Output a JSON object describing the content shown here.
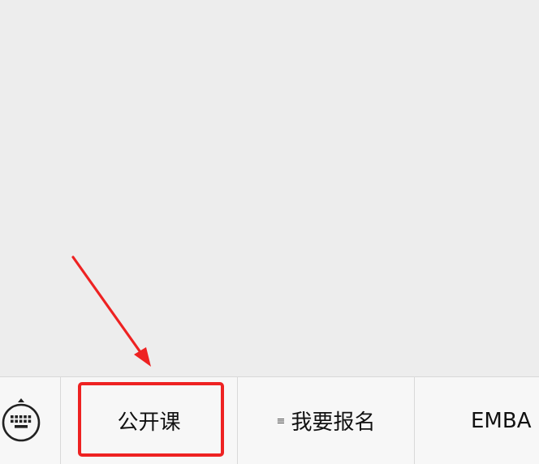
{
  "bottom_menu": {
    "items": [
      {
        "label": "公开课",
        "has_submenu": false
      },
      {
        "label": "我要报名",
        "has_submenu": true,
        "submenu_icon": "≡"
      },
      {
        "label": "EMBA",
        "has_submenu": false
      }
    ]
  },
  "icons": {
    "keyboard_toggle": "keyboard-icon",
    "submenu": "menu-lines-icon"
  },
  "colors": {
    "page_background": "#ededed",
    "menu_background": "#f7f7f7",
    "annotation_red": "#ee2222",
    "text": "#111111"
  }
}
